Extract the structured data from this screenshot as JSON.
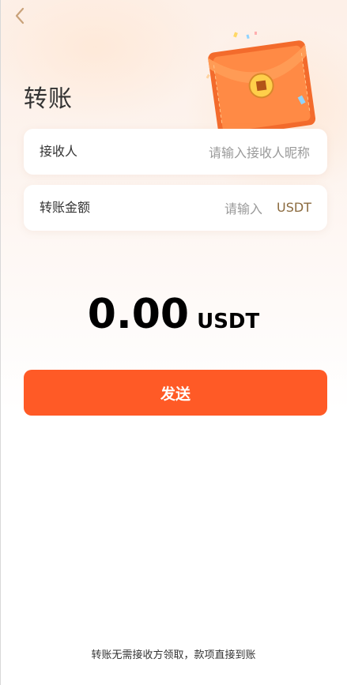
{
  "header": {
    "back_icon": "chevron-left-icon",
    "title": "转账"
  },
  "decoration": {
    "illustration": "red-envelope-icon"
  },
  "form": {
    "recipient": {
      "label": "接收人",
      "placeholder": "请输入接收人昵称",
      "value": ""
    },
    "amount": {
      "label": "转账金额",
      "placeholder": "请输入",
      "value": "",
      "unit": "USDT"
    }
  },
  "summary": {
    "amount": "0.00",
    "unit": "USDT"
  },
  "actions": {
    "send_label": "发送"
  },
  "footer": {
    "note": "转账无需接收方领取，款项直接到账"
  },
  "colors": {
    "accent": "#ff5a26",
    "unit_text": "#8b6b3f",
    "back_icon": "#c9a27a"
  }
}
